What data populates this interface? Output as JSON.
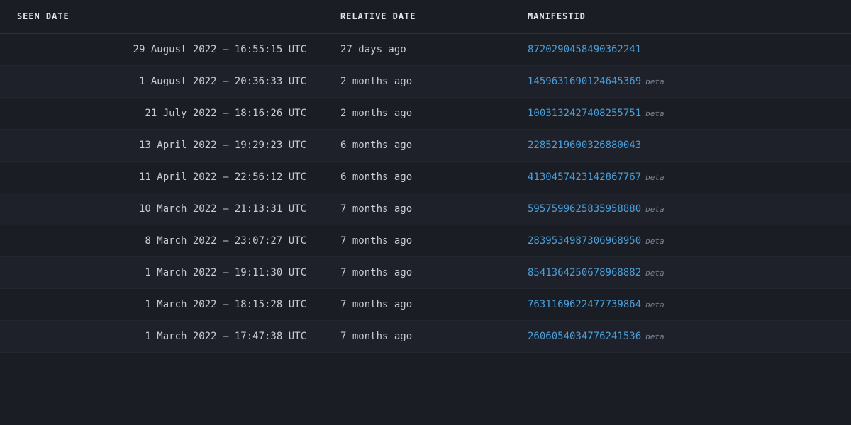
{
  "table": {
    "headers": [
      "SEEN DATE",
      "RELATIVE DATE",
      "MANIFESTID"
    ],
    "rows": [
      {
        "seen_date": "29 August 2022 – 16:55:15 UTC",
        "relative_date": "27 days ago",
        "manifest_id": "8720290458490362241",
        "beta": false
      },
      {
        "seen_date": "1 August 2022 – 20:36:33 UTC",
        "relative_date": "2 months ago",
        "manifest_id": "1459631690124645369",
        "beta": true
      },
      {
        "seen_date": "21 July 2022 – 18:16:26 UTC",
        "relative_date": "2 months ago",
        "manifest_id": "1003132427408255751",
        "beta": true
      },
      {
        "seen_date": "13 April 2022 – 19:29:23 UTC",
        "relative_date": "6 months ago",
        "manifest_id": "2285219600326880043",
        "beta": false
      },
      {
        "seen_date": "11 April 2022 – 22:56:12 UTC",
        "relative_date": "6 months ago",
        "manifest_id": "4130457423142867767",
        "beta": true
      },
      {
        "seen_date": "10 March 2022 – 21:13:31 UTC",
        "relative_date": "7 months ago",
        "manifest_id": "5957599625835958880",
        "beta": true
      },
      {
        "seen_date": "8 March 2022 – 23:07:27 UTC",
        "relative_date": "7 months ago",
        "manifest_id": "2839534987306968950",
        "beta": true
      },
      {
        "seen_date": "1 March 2022 – 19:11:30 UTC",
        "relative_date": "7 months ago",
        "manifest_id": "8541364250678968882",
        "beta": true
      },
      {
        "seen_date": "1 March 2022 – 18:15:28 UTC",
        "relative_date": "7 months ago",
        "manifest_id": "7631169622477739864",
        "beta": true
      },
      {
        "seen_date": "1 March 2022 – 17:47:38 UTC",
        "relative_date": "7 months ago",
        "manifest_id": "2606054034776241536",
        "beta": true
      }
    ],
    "beta_label": "beta"
  }
}
